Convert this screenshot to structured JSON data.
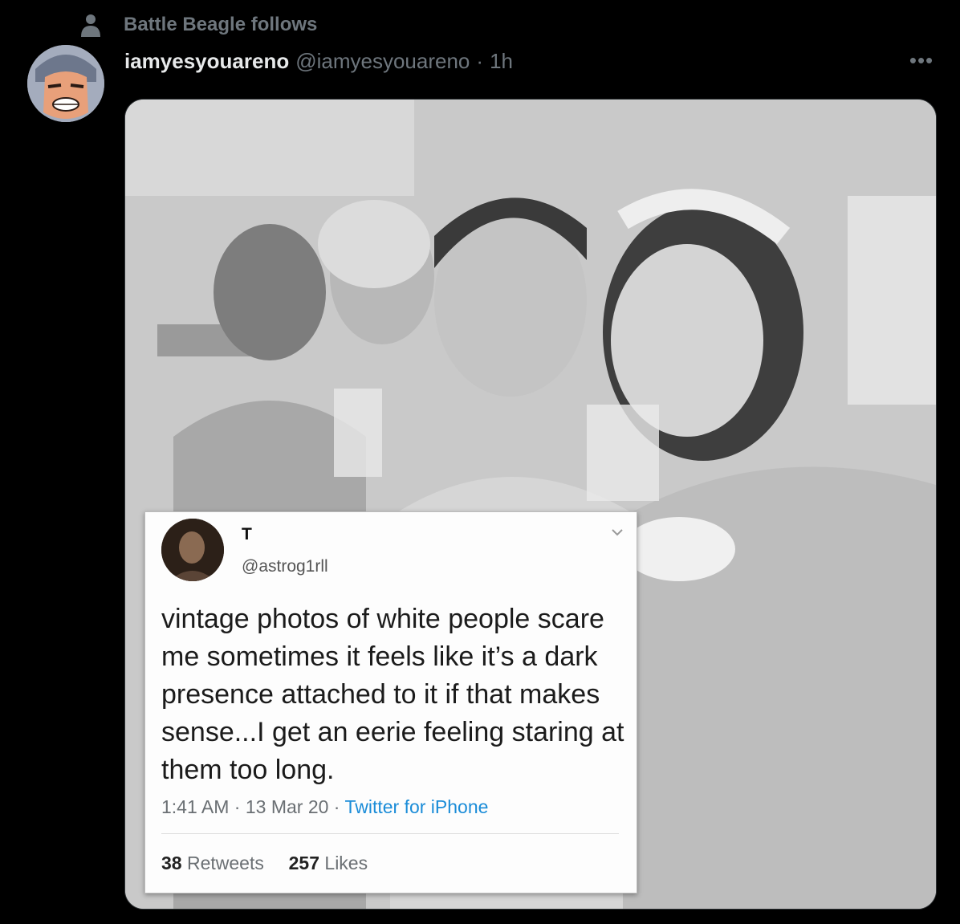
{
  "social_context": {
    "icon": "person-icon",
    "text": "Battle Beagle follows"
  },
  "tweet": {
    "display_name": "iamyesyouareno",
    "handle": "@iamyesyouareno",
    "separator": "·",
    "time": "1h",
    "more_label": "•••",
    "avatar": "cartoon-avatar"
  },
  "embedded_tweet": {
    "name": "T",
    "handle": "@astrog1rll",
    "text": "vintage photos of white people scare me sometimes it feels like it’s a dark presence attached to it if that makes sense...I get an eerie feeling staring at them too long.",
    "time": "1:41 AM",
    "date": "13 Mar 20",
    "meta_sep": "·",
    "source": "Twitter for iPhone",
    "retweets_count": "38",
    "retweets_label": "Retweets",
    "likes_count": "257",
    "likes_label": "Likes"
  },
  "colors": {
    "background": "#000000",
    "primary_text": "#e7e9ea",
    "secondary_text": "#6e767d",
    "link": "#1a8cd8"
  }
}
